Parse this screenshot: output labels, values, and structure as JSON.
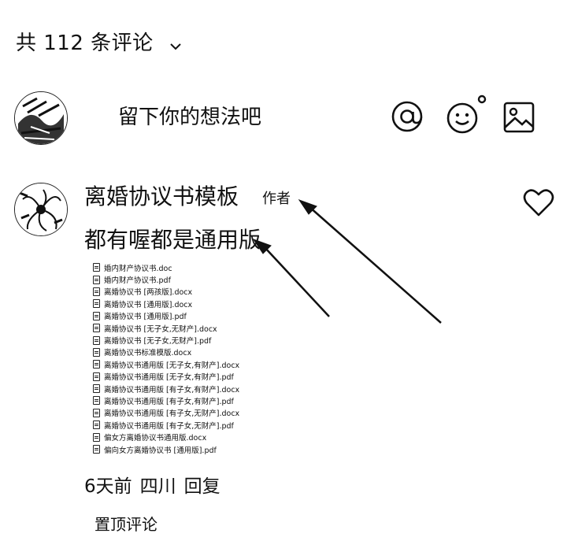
{
  "header": {
    "title": "共 112 条评论"
  },
  "input": {
    "placeholder": "留下你的想法吧"
  },
  "comment": {
    "username": "离婚协议书模板",
    "author_tag": "作者",
    "text": "都有喔都是通用版",
    "files": [
      "婚内财产协议书.doc",
      "婚内财产协议书.pdf",
      "离婚协议书 [两孩版].docx",
      "离婚协议书 [通用版].docx",
      "离婚协议书 [通用版].pdf",
      "离婚协议书 [无子女,无财产].docx",
      "离婚协议书 [无子女,无财产].pdf",
      "离婚协议书标准模版.docx",
      "离婚协议书通用版 [无子女,有财产].docx",
      "离婚协议书通用版 [无子女,有财产].pdf",
      "离婚协议书通用版 [有子女,有财产].docx",
      "离婚协议书通用版 [有子女,有财产].pdf",
      "离婚协议书通用版 [有子女,无财产].docx",
      "离婚协议书通用版 [有子女,无财产].pdf",
      "偏女方离婚协议书通用版.docx",
      "偏向女方离婚协议书 [通用版].pdf"
    ],
    "time": "6天前",
    "location": "四川",
    "reply_label": "回复",
    "pin_label": "置顶评论"
  }
}
